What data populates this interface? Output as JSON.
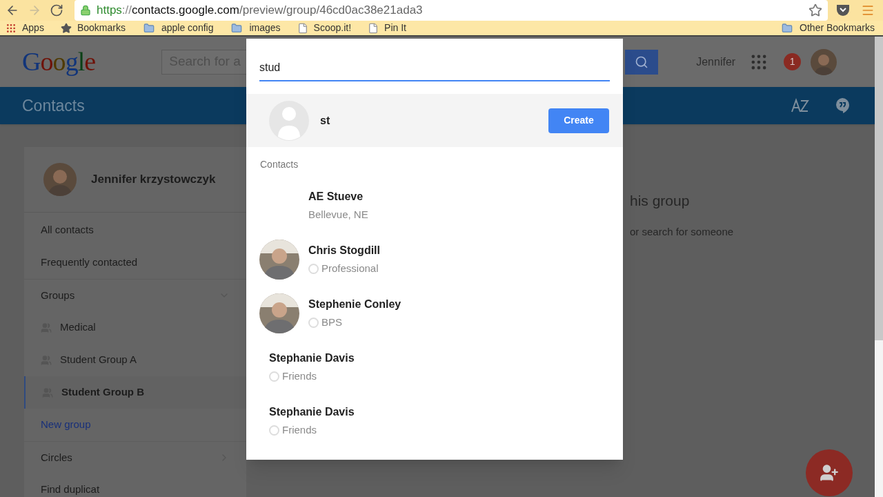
{
  "browser": {
    "url_scheme": "https",
    "url_separator": "://",
    "url_host": "contacts.google.com",
    "url_path": "/preview/group/46cd0ac38e21ada3",
    "bookmarks": [
      {
        "label": "Apps",
        "kind": "apps"
      },
      {
        "label": "Bookmarks",
        "kind": "star"
      },
      {
        "label": "apple config",
        "kind": "folder"
      },
      {
        "label": "images",
        "kind": "folder"
      },
      {
        "label": "Scoop.it!",
        "kind": "page"
      },
      {
        "label": "Pin It",
        "kind": "page"
      }
    ],
    "other_bookmarks": "Other Bookmarks"
  },
  "header": {
    "logo": "Google",
    "search_placeholder": "Search for a",
    "user": "Jennifer",
    "notifications": "1"
  },
  "app_bar": {
    "title": "Contacts"
  },
  "sidebar": {
    "profile_name": "Jennifer krzystowczyk",
    "items": [
      {
        "label": "All contacts",
        "kind": "item",
        "selected": false
      },
      {
        "label": "Frequently contacted",
        "kind": "item",
        "selected": false
      },
      {
        "label": "Groups",
        "kind": "section",
        "expanded": true
      },
      {
        "label": "Medical",
        "kind": "group",
        "selected": false
      },
      {
        "label": "Student Group A",
        "kind": "group",
        "selected": false
      },
      {
        "label": "Student Group B",
        "kind": "group",
        "selected": true
      },
      {
        "label": "New group",
        "kind": "link"
      },
      {
        "label": "Circles",
        "kind": "section",
        "expanded": false
      },
      {
        "label": "Find duplicat",
        "kind": "item",
        "selected": false
      }
    ]
  },
  "empty_state": {
    "title": "his group",
    "subtitle": "or search for someone"
  },
  "dialog": {
    "query": "stud",
    "suggestion": {
      "name": "st",
      "button": "Create"
    },
    "section": "Contacts",
    "contacts": [
      {
        "name": "AE Stueve",
        "detail": "Bellevue, NE",
        "kind": "location"
      },
      {
        "name": "Chris Stogdill",
        "detail": "Professional"
      },
      {
        "name": "Stephenie Conley",
        "detail": "BPS"
      },
      {
        "name": "Stephanie Davis",
        "detail": "Friends",
        "kind": "plain"
      },
      {
        "name": "Stephanie Davis",
        "detail": "Friends",
        "kind": "plain"
      }
    ]
  }
}
